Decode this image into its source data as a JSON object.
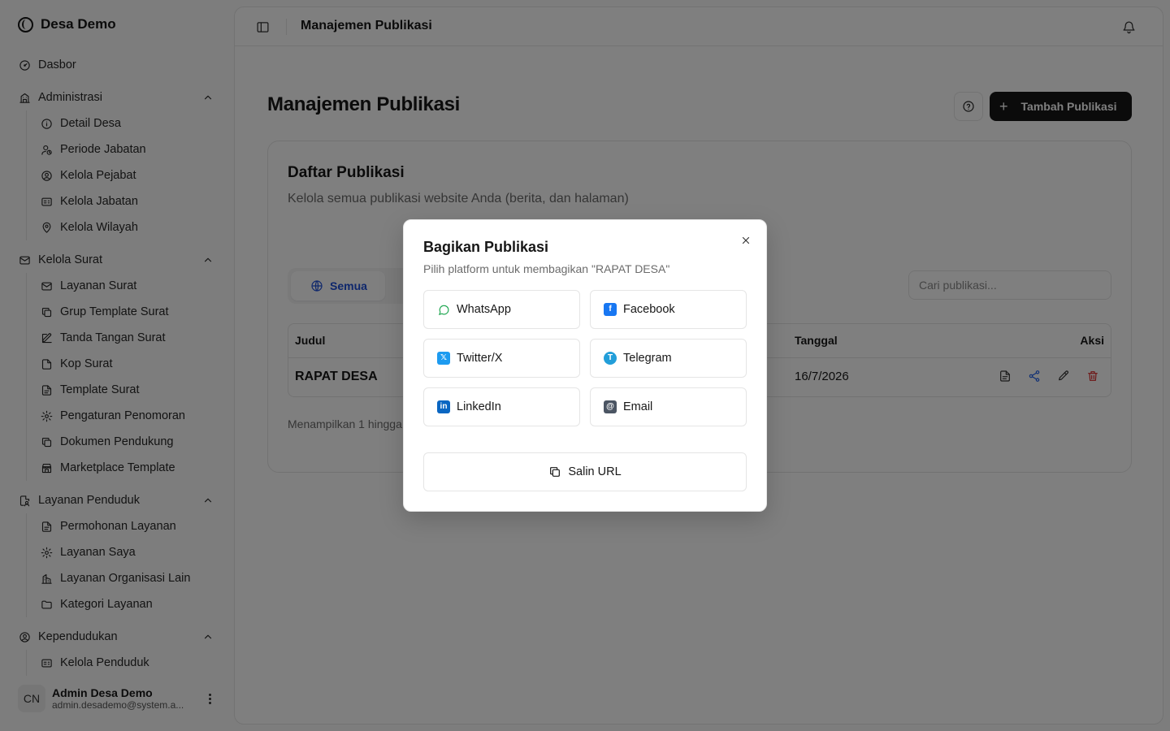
{
  "sidebar": {
    "brand": "Desa Demo",
    "top_item": "Dasbor",
    "groups": [
      {
        "label": "Administrasi",
        "items": [
          "Detail Desa",
          "Periode Jabatan",
          "Kelola Pejabat",
          "Kelola Jabatan",
          "Kelola Wilayah"
        ]
      },
      {
        "label": "Kelola Surat",
        "items": [
          "Layanan Surat",
          "Grup Template Surat",
          "Tanda Tangan Surat",
          "Kop Surat",
          "Template Surat",
          "Pengaturan Penomoran",
          "Dokumen Pendukung",
          "Marketplace Template"
        ]
      },
      {
        "label": "Layanan Penduduk",
        "items": [
          "Permohonan Layanan",
          "Layanan Saya",
          "Layanan Organisasi Lain",
          "Kategori Layanan"
        ]
      },
      {
        "label": "Kependudukan",
        "items": [
          "Kelola Penduduk"
        ]
      }
    ],
    "user": {
      "initials": "CN",
      "name": "Admin Desa Demo",
      "email": "admin.desademo@system.a..."
    }
  },
  "topbar": {
    "title": "Manajemen Publikasi"
  },
  "main": {
    "page_title": "Manajemen Publikasi",
    "add_button": "Tambah Publikasi",
    "card": {
      "title": "Daftar Publikasi",
      "description": "Kelola semua publikasi website Anda (berita, dan halaman)",
      "active_tab": "Semua",
      "search_placeholder": "Cari publikasi...",
      "table": {
        "headers": {
          "title": "Judul",
          "date": "Tanggal",
          "actions": "Aksi"
        },
        "rows": [
          {
            "title": "RAPAT DESA",
            "date": "16/7/2026"
          }
        ]
      },
      "footer": "Menampilkan 1 hingga"
    }
  },
  "modal": {
    "title": "Bagikan Publikasi",
    "description": "Pilih platform untuk membagikan \"RAPAT DESA\"",
    "platforms": {
      "whatsapp": "WhatsApp",
      "facebook": "Facebook",
      "twitter": "Twitter/X",
      "telegram": "Telegram",
      "linkedin": "LinkedIn",
      "email": "Email"
    },
    "copy_url": "Salin URL"
  },
  "colors": {
    "primary_button": "#171717",
    "tab_active": "#1d4ed8",
    "facebook": "#1877f2",
    "twitter": "#1d9bf0",
    "telegram": "#229ed9",
    "linkedin": "#0a66c2",
    "email": "#4b5563",
    "whatsapp": "#16a34a",
    "delete": "#dc2626",
    "share_action": "#2563eb"
  },
  "icons": {
    "dashboard": "gauge-icon",
    "administration": "building-icon",
    "letters": "mail-icon",
    "citizen_services": "file-user-icon",
    "population": "user-circle-icon"
  }
}
